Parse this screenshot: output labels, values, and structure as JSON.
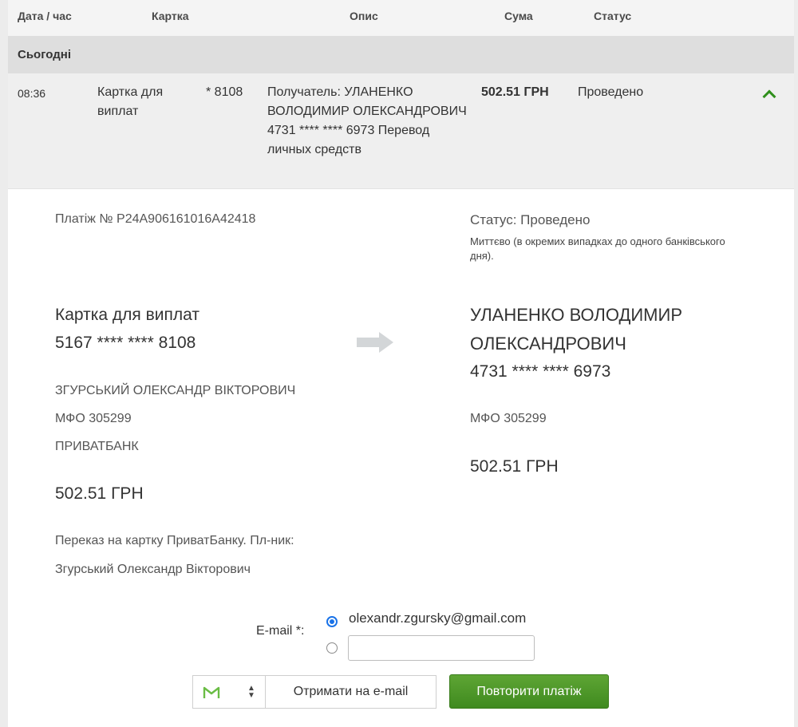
{
  "table": {
    "headers": {
      "datetime": "Дата / час",
      "card": "Картка",
      "description": "Опис",
      "amount": "Сума",
      "status": "Статус"
    },
    "group_label": "Сьогодні",
    "row": {
      "time": "08:36",
      "card_name": "Картка для виплат",
      "card_mask": "* 8108",
      "description": "Получатель: УЛАНЕНКО ВОЛОДИМИР ОЛЕКСАНДРОВИЧ 4731 **** **** 6973 Перевод личных средств",
      "amount": "502.51 ГРН",
      "status": "Проведено"
    }
  },
  "details": {
    "payment_no": "Платіж № P24A906161016A42418",
    "status": "Статус: Проведено",
    "status_note": "Миттєво (в окремих випадках до одного банківського дня).",
    "sender": {
      "card_name": "Картка для виплат",
      "card_number": "5167 **** **** 8108",
      "owner": "ЗГУРСЬКИЙ ОЛЕКСАНДР ВІКТОРОВИЧ",
      "mfo": "МФО 305299",
      "bank": "ПРИВАТБАНК",
      "amount": "502.51 ГРН"
    },
    "purpose_line1": "Переказ на картку ПриватБанку. Пл-ник:",
    "purpose_line2": "Згурський Олександр Вікторович",
    "receiver": {
      "name_line1": "УЛАНЕНКО ВОЛОДИМИР",
      "name_line2": "ОЛЕКСАНДРОВИЧ",
      "card_number": "4731 **** **** 6973",
      "mfo": "МФО 305299",
      "amount": "502.51 ГРН"
    }
  },
  "email": {
    "label": "E-mail *:",
    "saved_value": "olexandr.zgursky@gmail.com",
    "custom_value": "",
    "selected": "saved"
  },
  "actions": {
    "mail_service_icon": "gmail-icon",
    "send_email_label": "Отримати на e-mail",
    "repeat_label": "Повторити платіж"
  },
  "colors": {
    "accent_green": "#4c9a28",
    "radio_blue": "#1a73e8"
  }
}
